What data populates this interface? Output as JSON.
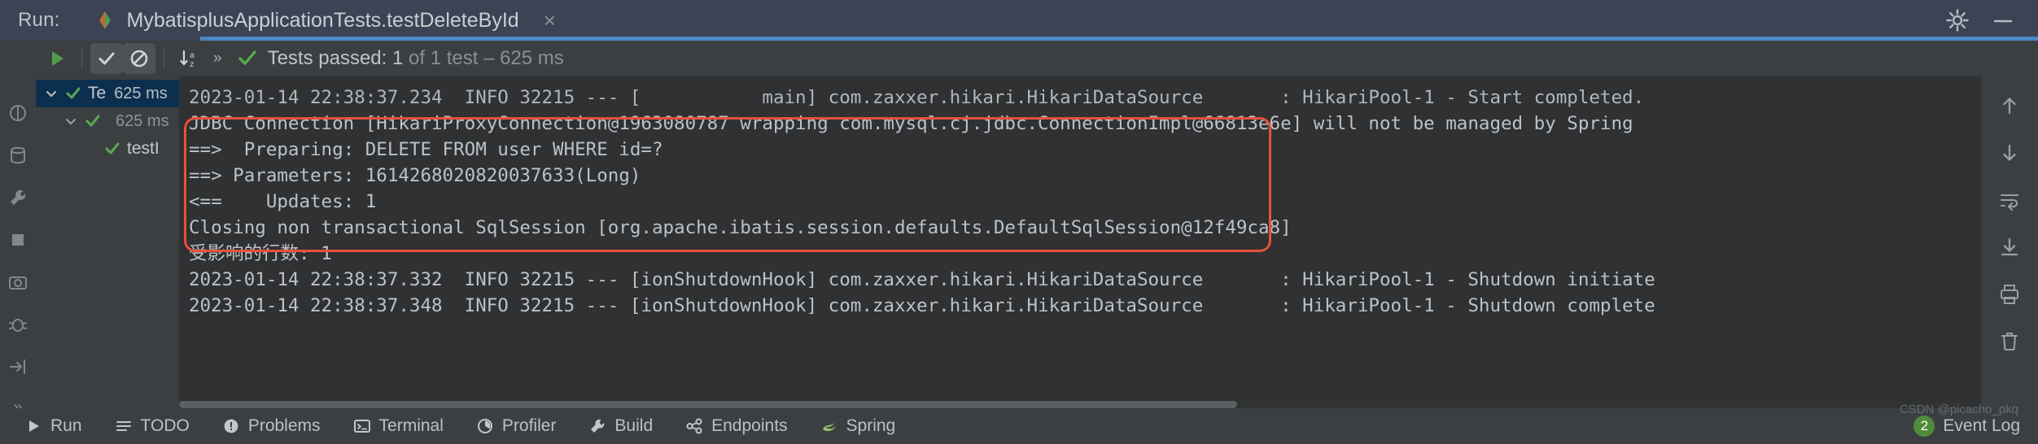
{
  "titlebar": {
    "run_label": "Run:",
    "tab_title": "MybatisplusApplicationTests.testDeleteById",
    "close_label": "×",
    "settings_icon": "gear-icon",
    "minimize_icon": "minimize-icon"
  },
  "gutter": {
    "items": [
      {
        "icon": "structure-icon"
      },
      {
        "icon": "database-icon"
      },
      {
        "icon": "build-tools-icon"
      },
      {
        "icon": "stop-icon"
      },
      {
        "icon": "camera-icon"
      },
      {
        "icon": "bug-icon"
      },
      {
        "icon": "export-icon"
      }
    ],
    "more_label": "»"
  },
  "toolbar": {
    "rerun_icon": "play-icon",
    "show_passed_icon": "checkmark-icon",
    "show_ignored_icon": "ignored-icon",
    "sort_alphabetically_icon": "sort-alpha-icon",
    "expand_icon": "chevrons-right-icon",
    "expand_label": "»",
    "status_icon": "green-check-icon",
    "status_prefix": "Tests passed: 1",
    "status_suffix": " of 1 test – 625 ms"
  },
  "tree": {
    "rows": [
      {
        "label": "Te",
        "time": "625 ms",
        "selected": true,
        "indent": 0,
        "chevron": "chevron-down-icon",
        "status": "passed"
      },
      {
        "label": "",
        "time": "625 ms",
        "selected": false,
        "indent": 1,
        "chevron": "chevron-down-icon",
        "status": "passed"
      },
      {
        "label": "testI",
        "time": "",
        "selected": false,
        "indent": 2,
        "chevron": "",
        "status": "passed"
      }
    ]
  },
  "console": {
    "lines": [
      "2023-01-14 22:38:37.234  INFO 32215 --- [           main] com.zaxxer.hikari.HikariDataSource       : HikariPool-1 - Start completed.",
      "JDBC Connection [HikariProxyConnection@1963080787 wrapping com.mysql.cj.jdbc.ConnectionImpl@66813e6e] will not be managed by Spring",
      "==>  Preparing: DELETE FROM user WHERE id=?",
      "==> Parameters: 1614268020820037633(Long)",
      "<==    Updates: 1",
      "Closing non transactional SqlSession [org.apache.ibatis.session.defaults.DefaultSqlSession@12f49ca8]",
      "受影响的行数: 1",
      "2023-01-14 22:38:37.332  INFO 32215 --- [ionShutdownHook] com.zaxxer.hikari.HikariDataSource       : HikariPool-1 - Shutdown initiate",
      "2023-01-14 22:38:37.348  INFO 32215 --- [ionShutdownHook] com.zaxxer.hikari.HikariDataSource       : HikariPool-1 - Shutdown complete"
    ],
    "highlight_color": "#e8503a"
  },
  "rail": {
    "items": [
      {
        "icon": "arrow-up-icon"
      },
      {
        "icon": "arrow-down-icon"
      },
      {
        "icon": "soft-wrap-icon"
      },
      {
        "icon": "scroll-to-end-icon"
      },
      {
        "icon": "print-icon"
      },
      {
        "icon": "trash-icon"
      }
    ]
  },
  "bottombar": {
    "items": [
      {
        "label": "Run",
        "icon": "play-icon"
      },
      {
        "label": "TODO",
        "icon": "todo-icon"
      },
      {
        "label": "Problems",
        "icon": "problems-icon"
      },
      {
        "label": "Terminal",
        "icon": "terminal-icon"
      },
      {
        "label": "Profiler",
        "icon": "profiler-icon"
      },
      {
        "label": "Build",
        "icon": "build-icon"
      },
      {
        "label": "Endpoints",
        "icon": "endpoints-icon"
      },
      {
        "label": "Spring",
        "icon": "spring-icon"
      }
    ],
    "event_log_label": "Event Log",
    "event_log_count": "2",
    "watermark": "CSDN @picacho_pkq"
  }
}
